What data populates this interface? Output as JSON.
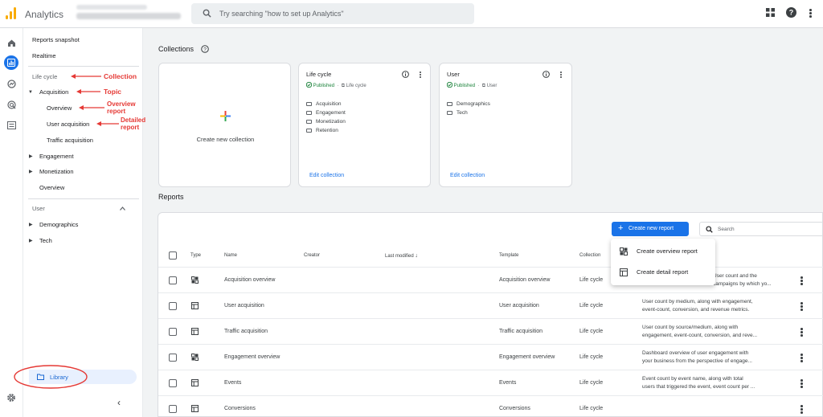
{
  "app": {
    "title": "Analytics",
    "search_placeholder": "Try searching \"how to set up Analytics\""
  },
  "colors": {
    "accent": "#1a73e8",
    "published": "#188038",
    "annotation": "#e53935",
    "logo": "#f9ab00"
  },
  "nav": {
    "reports_snapshot": "Reports snapshot",
    "realtime": "Realtime",
    "lifecycle_header": "Life cycle",
    "acquisition": "Acquisition",
    "overview": "Overview",
    "user_acquisition": "User acquisition",
    "traffic_acquisition": "Traffic acquisition",
    "engagement": "Engagement",
    "monetization": "Monetization",
    "overview2": "Overview",
    "user_header": "User",
    "demographics": "Demographics",
    "tech": "Tech",
    "library": "Library"
  },
  "annotations": {
    "collection": "Collection",
    "topic": "Topic",
    "overview_report_1": "Overview",
    "overview_report_2": "report",
    "detailed_report_1": "Detailed",
    "detailed_report_2": "report"
  },
  "collections": {
    "title": "Collections",
    "create_label": "Create new collection",
    "cards": [
      {
        "title": "Life cycle",
        "status": "Published",
        "kind": "Life cycle",
        "items": [
          "Acquisition",
          "Engagement",
          "Monetization",
          "Retention"
        ],
        "edit": "Edit collection"
      },
      {
        "title": "User",
        "status": "Published",
        "kind": "User",
        "items": [
          "Demographics",
          "Tech"
        ],
        "edit": "Edit collection"
      }
    ]
  },
  "reports": {
    "title": "Reports",
    "create_button": "Create new report",
    "search_placeholder": "Search",
    "menu": [
      "Create overview report",
      "Create detail report"
    ],
    "columns": {
      "type": "Type",
      "name": "Name",
      "creator": "Creator",
      "modified": "Last modified",
      "template": "Template",
      "collection": "Collection"
    },
    "rows": [
      {
        "type_icon": "overview-type-icon",
        "name": "Acquisition overview",
        "template": "Acquisition overview",
        "collection": "Life cycle",
        "desc1": "User count and the",
        "desc2": "campaigns by which yo..."
      },
      {
        "type_icon": "detail-type-icon",
        "name": "User acquisition",
        "template": "User acquisition",
        "collection": "Life cycle",
        "desc1": "User count by medium, along with engagement,",
        "desc2": "event-count, conversion, and revenue metrics."
      },
      {
        "type_icon": "detail-type-icon",
        "name": "Traffic acquisition",
        "template": "Traffic acquisition",
        "collection": "Life cycle",
        "desc1": "User count by source/medium, along with",
        "desc2": "engagement, event-count, conversion, and reve..."
      },
      {
        "type_icon": "overview-type-icon",
        "name": "Engagement overview",
        "template": "Engagement overview",
        "collection": "Life cycle",
        "desc1": "Dashboard overview of user engagement with",
        "desc2": "your business from the perspective of engage..."
      },
      {
        "type_icon": "detail-type-icon",
        "name": "Events",
        "template": "Events",
        "collection": "Life cycle",
        "desc1": "Event count by event name, along with total",
        "desc2": "users that triggered the event, event count per ..."
      },
      {
        "type_icon": "detail-type-icon",
        "name": "Conversions",
        "template": "Conversions",
        "collection": "Life cycle",
        "desc1": "",
        "desc2": ""
      }
    ]
  }
}
